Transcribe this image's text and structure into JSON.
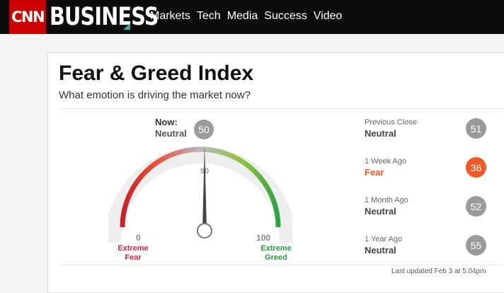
{
  "header": {
    "logo": "CNN",
    "brand": "BUSINESS",
    "nav": [
      "Markets",
      "Tech",
      "Media",
      "Success",
      "Video"
    ]
  },
  "widget": {
    "title": "Fear & Greed Index",
    "subtitle": "What emotion is driving the market now?",
    "now": {
      "label": "Now:",
      "sentiment": "Neutral",
      "value": 50
    },
    "scale": {
      "min_label": "0",
      "mid_label": "50",
      "max_label": "100",
      "low_label": "Extreme Fear",
      "high_label": "Extreme Greed"
    },
    "history": [
      {
        "period": "Previous Close",
        "sentiment": "Neutral",
        "value": "51",
        "color": "#9a9a9a",
        "text_color": "#444444"
      },
      {
        "period": "1 Week Ago",
        "sentiment": "Fear",
        "value": "36",
        "color": "#f15a24",
        "text_color": "#f15a24"
      },
      {
        "period": "1 Month Ago",
        "sentiment": "Neutral",
        "value": "52",
        "color": "#9a9a9a",
        "text_color": "#444444"
      },
      {
        "period": "1 Year Ago",
        "sentiment": "Neutral",
        "value": "55",
        "color": "#9a9a9a",
        "text_color": "#444444"
      }
    ],
    "last_updated": "Last updated Feb 3 at 5:04pm",
    "colors": {
      "extreme_fear": "#d0273c",
      "neutral": "#9a9a9a",
      "extreme_greed": "#2b9a43"
    }
  }
}
